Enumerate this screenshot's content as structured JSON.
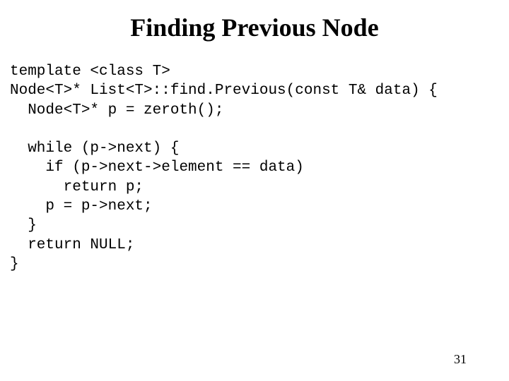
{
  "title": "Finding Previous Node",
  "code": "template <class T>\nNode<T>* List<T>::find.Previous(const T& data) {\n  Node<T>* p = zeroth();\n\n  while (p->next) {\n    if (p->next->element == data)\n      return p;\n    p = p->next;\n  }\n  return NULL;\n}",
  "page_number": "31"
}
